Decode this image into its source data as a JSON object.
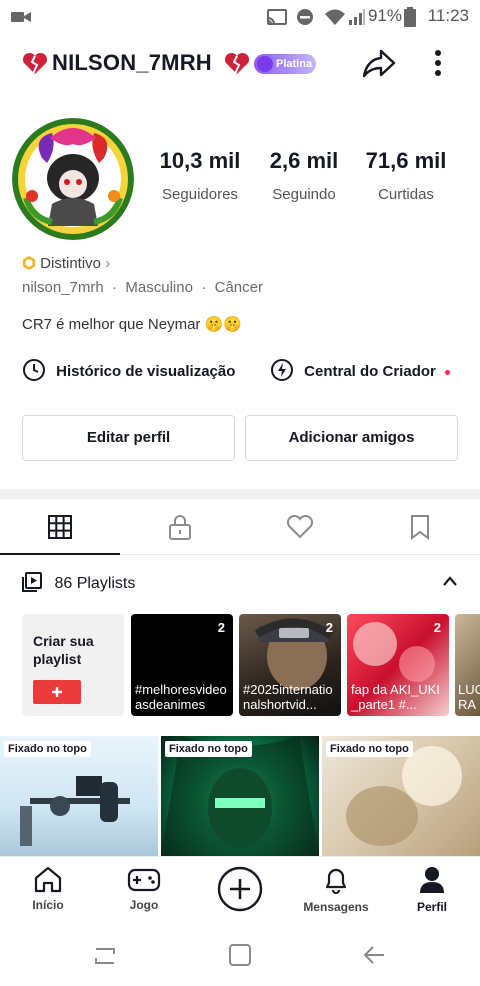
{
  "status_bar": {
    "battery": "91%",
    "time": "11:23"
  },
  "header": {
    "username": "NILSON_7MRH",
    "badge": "Platina"
  },
  "stats": [
    {
      "value": "10,3 mil",
      "label": "Seguidores"
    },
    {
      "value": "2,6 mil",
      "label": "Seguindo"
    },
    {
      "value": "71,6 mil",
      "label": "Curtidas"
    }
  ],
  "profile": {
    "badge_link": "Distintivo",
    "handle": "nilson_7mrh",
    "gender": "Masculino",
    "sign": "Câncer",
    "bio": "CR7 é melhor que Neymar 🤫🤫"
  },
  "links": {
    "history": "Histórico de visualização",
    "creator": "Central do Criador"
  },
  "buttons": {
    "edit": "Editar perfil",
    "add_friends": "Adicionar amigos"
  },
  "playlists": {
    "header": "86 Playlists",
    "create_label": "Criar sua playlist",
    "items": [
      {
        "count": "2",
        "title": "#melhoresvideoasdeanimes"
      },
      {
        "count": "2",
        "title": "#2025internationalshortvid..."
      },
      {
        "count": "2",
        "title": "fap da AKI_UKI_parte1 #..."
      },
      {
        "count": "",
        "title": "LUC RA"
      }
    ]
  },
  "videos": [
    {
      "pin_label": "Fixado no topo"
    },
    {
      "pin_label": "Fixado no topo"
    },
    {
      "pin_label": "Fixado no topo"
    }
  ],
  "bottom_nav": [
    {
      "label": "Início"
    },
    {
      "label": "Jogo"
    },
    {
      "label": ""
    },
    {
      "label": "Mensagens"
    },
    {
      "label": "Perfil"
    }
  ],
  "colors": {
    "accent_red": "#fe2c55",
    "platina_purple": "#8b5cf6",
    "text": "#161823"
  }
}
